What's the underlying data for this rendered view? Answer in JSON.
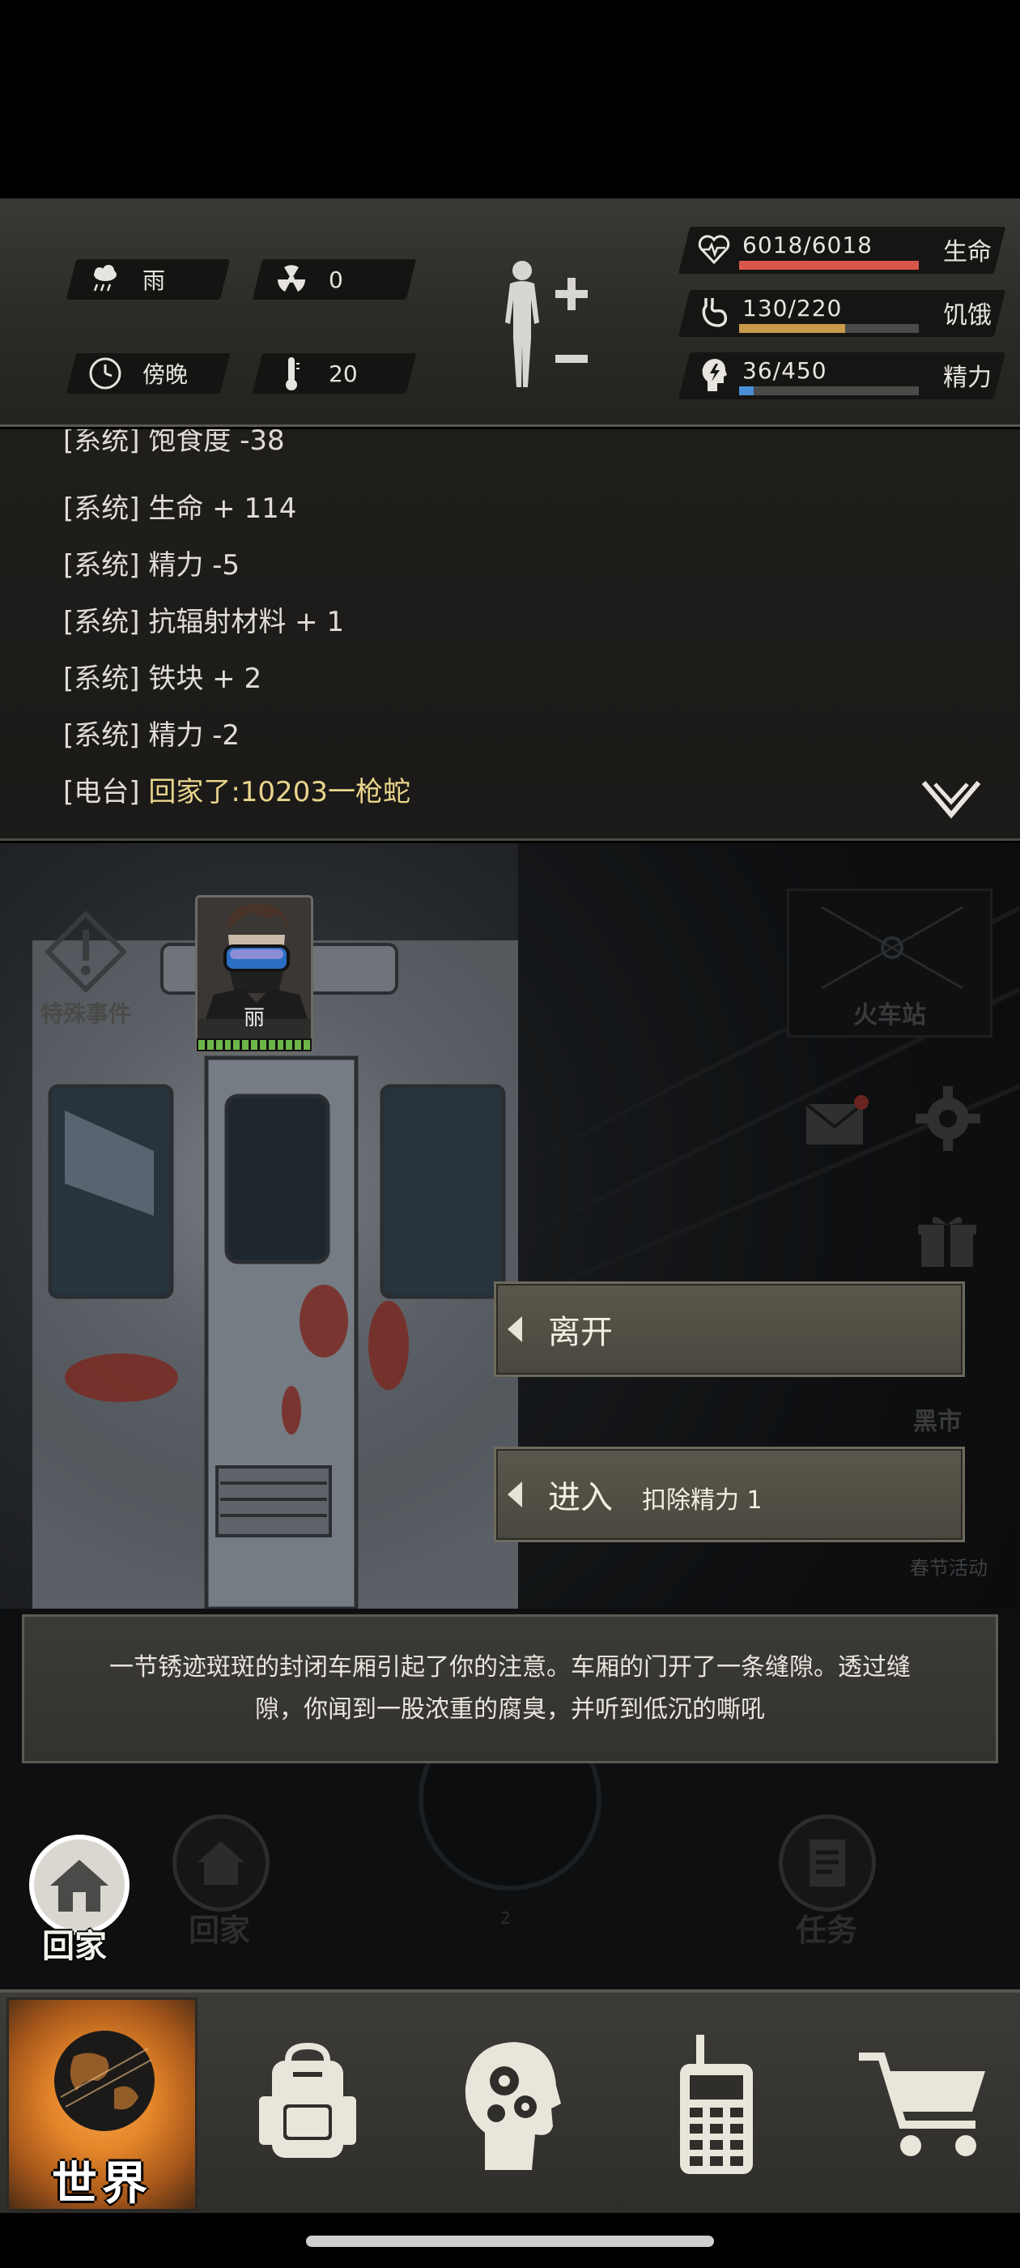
{
  "status": {
    "weather": {
      "icon": "rain-cloud-icon",
      "label": "雨"
    },
    "radiation": {
      "icon": "radiation-icon",
      "value": "0"
    },
    "time": {
      "icon": "clock-icon",
      "label": "傍晚"
    },
    "temperature": {
      "icon": "thermometer-icon",
      "value": "20"
    },
    "body_controls": {
      "plus": "+",
      "minus": "−"
    },
    "bars": [
      {
        "key": "life",
        "icon": "heart-icon",
        "value": "6018/6018",
        "label": "生命",
        "fill": 1.0,
        "color": "#d9574a"
      },
      {
        "key": "hunger",
        "icon": "stomach-icon",
        "value": "130/220",
        "label": "饥饿",
        "fill": 0.59,
        "color": "#c89a4a"
      },
      {
        "key": "energy",
        "icon": "lightning-head-icon",
        "value": "36/450",
        "label": "精力",
        "fill": 0.08,
        "color": "#4a8fd6"
      }
    ]
  },
  "log": {
    "lines": [
      {
        "tag": "[系统]",
        "msg": "饱食度 -38"
      },
      {
        "tag": "[系统]",
        "msg": "生命 + 114"
      },
      {
        "tag": "[系统]",
        "msg": "精力 -5"
      },
      {
        "tag": "[系统]",
        "msg": "抗辐射材料 + 1"
      },
      {
        "tag": "[系统]",
        "msg": "铁块 + 2"
      },
      {
        "tag": "[系统]",
        "msg": "精力 -2"
      },
      {
        "tag": "[电台]",
        "msg": "回家了:10203一枪蛇"
      }
    ]
  },
  "scene": {
    "special_event": "特殊事件",
    "station": "火车站",
    "black_market": "黑市",
    "festival": "春节活动",
    "character_name": "丽",
    "choices": [
      {
        "label": "离开",
        "sub": ""
      },
      {
        "label": "进入",
        "sub": "扣除精力 1"
      }
    ],
    "description": "一节锈迹斑斑的封闭车厢引起了你的注意。车厢的门开了一条缝隙。透过缝隙，你闻到一股浓重的腐臭，并听到低沉的嘶吼",
    "home_button": "回家",
    "ghost_home": "回家",
    "ghost_task": "任务",
    "radar_count": "2"
  },
  "nav": {
    "world": "世界",
    "items": [
      "backpack-icon",
      "brain-gears-icon",
      "walkie-talkie-icon",
      "shopping-cart-icon"
    ]
  }
}
